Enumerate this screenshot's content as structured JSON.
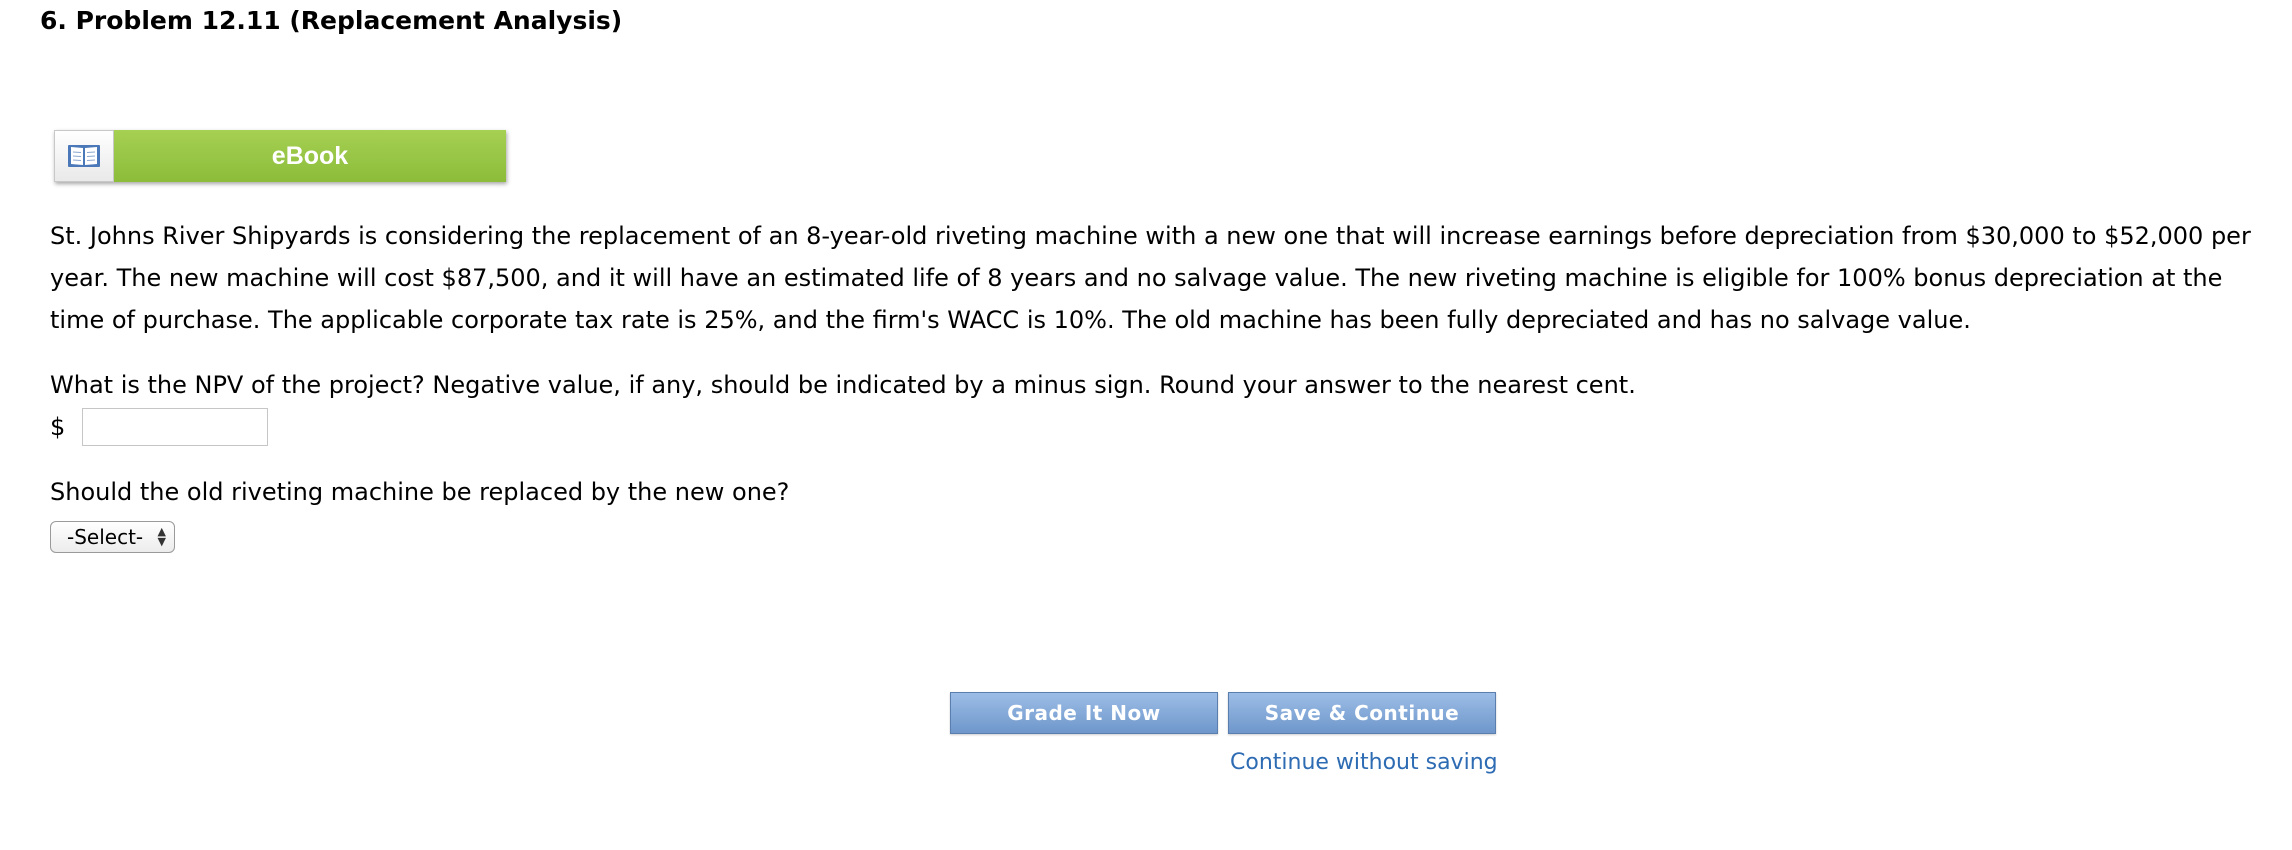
{
  "problem": {
    "title": "6.  Problem 12.11 (Replacement Analysis)",
    "ebook_label": "eBook",
    "text": "St. Johns River Shipyards is considering the replacement of an 8-year-old riveting machine with a new one that will increase earnings before depreciation from $30,000 to $52,000 per year. The new machine will cost $87,500, and it will have an estimated life of 8 years and no salvage value. The new riveting machine is eligible for 100% bonus depreciation at the time of purchase. The applicable corporate tax rate is 25%, and the firm's WACC is 10%. The old machine has been fully depreciated and has no salvage value."
  },
  "question1": {
    "text": "What is the NPV of the project? Negative value, if any, should be indicated by a minus sign. Round your answer to the nearest cent.",
    "currency_symbol": "$",
    "input_value": ""
  },
  "question2": {
    "text": "Should the old riveting machine be replaced by the new one?",
    "selected": "-Select-"
  },
  "actions": {
    "grade_label": "Grade It Now",
    "save_label": "Save & Continue",
    "continue_label": "Continue without saving"
  },
  "icons": {
    "ebook": "book-icon",
    "select": "updown-arrows-icon"
  },
  "colors": {
    "ebook_green": "#8cbc3a",
    "button_blue": "#6f97cb",
    "link_blue": "#2d6bb3"
  }
}
